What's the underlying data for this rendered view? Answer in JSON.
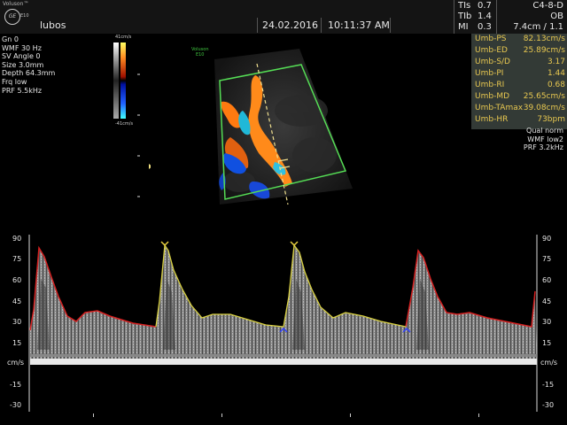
{
  "header": {
    "logo_text": "Voluson™",
    "logo_mark": "GE",
    "logo_sub": "E10",
    "patient": "lubos",
    "date": "24.02.2016",
    "time": "10:11:37 AM",
    "tis": [
      {
        "label": "TIs",
        "value": "0.7"
      },
      {
        "label": "TIb",
        "value": "1.4"
      },
      {
        "label": "MI",
        "value": "0.3"
      }
    ],
    "probe": "C4-8-D",
    "preset": "OB",
    "depth_zoom": "7.4cm / 1.1"
  },
  "params": [
    "Gn  0",
    "WMF 30 Hz",
    "SV Angle  0",
    "Size  3.0mm",
    "Depth 64.3mm",
    "Frq low",
    "PRF  5.5kHz"
  ],
  "colorbar": {
    "top": "41cm/s",
    "bottom": "-41cm/s"
  },
  "image_logo": {
    "line1": "Voluson",
    "line2": "E10"
  },
  "measurements": [
    {
      "label": "Umb-PS",
      "value": "82.13cm/s"
    },
    {
      "label": "Umb-ED",
      "value": "25.89cm/s"
    },
    {
      "label": "Umb-S/D",
      "value": "3.17"
    },
    {
      "label": "Umb-PI",
      "value": "1.44"
    },
    {
      "label": "Umb-RI",
      "value": "0.68"
    },
    {
      "label": "Umb-MD",
      "value": "25.65cm/s"
    },
    {
      "label": "Umb-TAmax",
      "value": "39.08cm/s"
    },
    {
      "label": "Umb-HR",
      "value": "73bpm"
    }
  ],
  "right_params": [
    "Qual norm",
    "WMF low2",
    "PRF  3.2kHz"
  ],
  "axis": {
    "ticks": [
      "90",
      "75",
      "60",
      "45",
      "30",
      "15",
      "-15",
      "-30"
    ],
    "unit": "cm/s"
  },
  "colors": {
    "envelope_red": "#d42020",
    "envelope_yellow": "#d8d040",
    "roi": "#55dd55",
    "meas_text": "#e8c850"
  }
}
